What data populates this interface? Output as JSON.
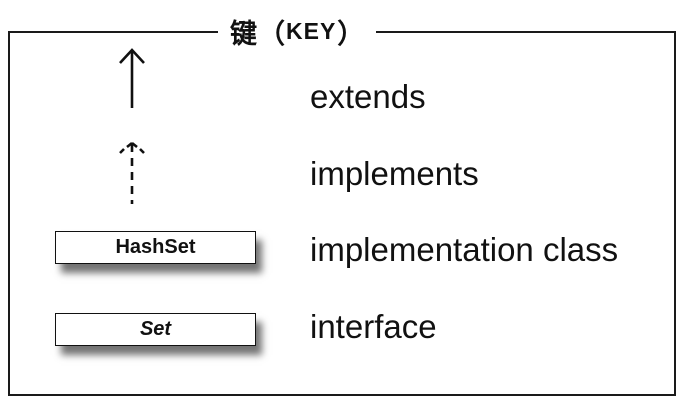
{
  "key": {
    "title_cjk": "键",
    "title_open": "（",
    "title_key": "KEY",
    "title_close": "）"
  },
  "legend": [
    {
      "symbol": "solid-arrow",
      "label": "extends"
    },
    {
      "symbol": "dashed-arrow",
      "label": "implements"
    },
    {
      "symbol": "class-box",
      "box_text": "HashSet",
      "label": "implementation class"
    },
    {
      "symbol": "interface-box",
      "box_text": "Set",
      "label": "interface"
    }
  ]
}
